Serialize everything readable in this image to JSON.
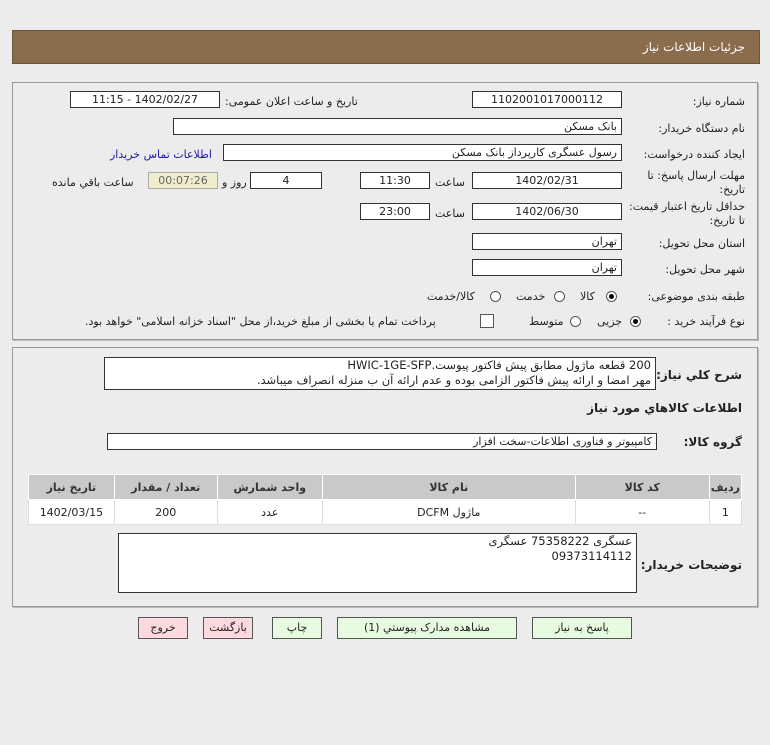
{
  "header": {
    "title": "جزئیات اطلاعات نیاز"
  },
  "form": {
    "need_number_label": "شماره نیاز:",
    "need_number": "1102001017000112",
    "announce_label": "تاریخ و ساعت اعلان عمومی:",
    "announce_value": "1402/02/27 - 11:15",
    "buyer_org_label": "نام دستگاه خریدار:",
    "buyer_org": "بانک مسکن",
    "creator_label": "ایجاد کننده درخواست:",
    "creator": "رسول عسگری کارپرداز بانک مسکن",
    "contact_link": "اطلاعات تماس خریدار",
    "deadline_label": "مهلت ارسال پاسخ: تا تاریخ:",
    "deadline_date": "1402/02/31",
    "time_label": "ساعت",
    "deadline_time": "11:30",
    "days": "4",
    "days_label": "روز و",
    "remaining": "00:07:26",
    "remaining_label": "ساعت باقي مانده",
    "validity_label": "حداقل تاریخ اعتبار قیمت: تا تاریخ:",
    "validity_date": "1402/06/30",
    "validity_time": "23:00",
    "province_label": "استان محل تحویل:",
    "province": "تهران",
    "city_label": "شهر محل تحویل:",
    "city": "تهران",
    "category_label": "طبقه بندی موضوعی:",
    "category_options": [
      "کالا",
      "خدمت",
      "کالا/خدمت"
    ],
    "category_selected": "کالا",
    "process_label": "نوع فرآیند خرید :",
    "process_options": [
      "جزیی",
      "متوسط"
    ],
    "process_selected": "جزیی",
    "payment_note": "پرداخت تمام یا بخشی از مبلغ خرید،از محل \"اسناد خزانه اسلامی\" خواهد بود."
  },
  "details": {
    "desc_label": "شرح کلي نياز:",
    "desc_line1": "200 قطعه ماژول مطابق پیش فاکتور پیوست.HWIC-1GE-SFP",
    "desc_line2": "مهر امضا و ارائه پیش فاکتور الزامی بوده و عدم ارائه آن ب منزله انصراف میباشد.",
    "goods_title": "اطلاعات كالاهاي مورد نياز",
    "group_label": "گروه کالا:",
    "group_value": "کامپیوتر و فناوری اطلاعات-سخت افزار",
    "table": {
      "headers": [
        "رديف",
        "کد کالا",
        "نام کالا",
        "واحد شمارش",
        "تعداد / مقدار",
        "تاریخ نیاز"
      ],
      "rows": [
        [
          "1",
          "--",
          "ماژول DCFM",
          "عدد",
          "200",
          "1402/03/15"
        ]
      ]
    },
    "notes_label": "توضیحات خریدار:",
    "notes_line1": "عسگری 75358222 عسگری",
    "notes_line2": "09373114112"
  },
  "buttons": {
    "reply": "پاسخ به نیاز",
    "attachments": "مشاهده مدارک پیوستي (1)",
    "print": "چاپ",
    "back": "بازگشت",
    "exit": "خروج"
  },
  "colors": {
    "header": "#8b6c4c",
    "green_button": "#e6fbe0",
    "red_button": "#fbd9dc",
    "timer": "#f0edcc"
  }
}
